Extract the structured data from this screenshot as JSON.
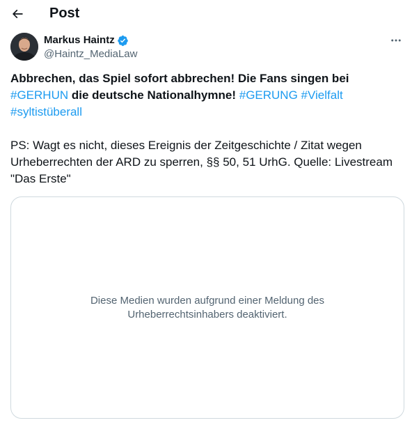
{
  "header": {
    "title": "Post",
    "back_icon": "arrow-left-icon"
  },
  "author": {
    "name": "Markus Haintz",
    "handle": "@Haintz_MediaLaw",
    "verified": true,
    "verified_color": "#1d9bf0"
  },
  "tweet": {
    "line1": "Abbrechen, das Spiel sofort abbrechen! Die Fans singen bei",
    "hashtag1": "#GERHUN",
    "line2_text": " die deutsche Nationalhymne! ",
    "hashtag2": "#GERUNG",
    "hashtag3": "#Vielfalt",
    "hashtag4": "#syltistüberall",
    "ps_line1": "PS: Wagt es nicht, dieses Ereignis der Zeitgeschichte / Zitat wegen",
    "ps_line2": "Urheberrechten der ARD zu sperren, §§ 50, 51 UrhG. Quelle: Livestream",
    "ps_line3": "\"Das Erste\""
  },
  "media": {
    "notice": "Diese Medien wurden aufgrund einer Meldung des Urheberrechtsinhabers deaktiviert."
  },
  "colors": {
    "accent": "#1d9bf0",
    "text": "#0f1419",
    "secondary": "#536471",
    "border": "#cfd9de"
  }
}
